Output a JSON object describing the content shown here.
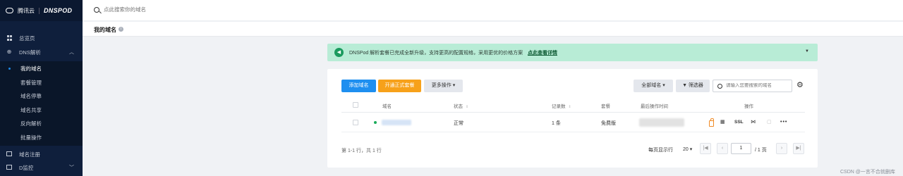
{
  "sidebar": {
    "brand": {
      "tencent": "腾讯云",
      "dnspod": "DNSPOD"
    },
    "items": [
      {
        "label": "总览页",
        "icon": "grid-icon"
      },
      {
        "label": "DNS解析",
        "icon": "globe-icon",
        "expanded": true
      },
      {
        "label": "我的域名",
        "active": true
      },
      {
        "label": "套餐管理"
      },
      {
        "label": "域名停靠"
      },
      {
        "label": "域名共享"
      },
      {
        "label": "反向解析"
      },
      {
        "label": "批量操作"
      },
      {
        "label": "域名注册",
        "icon": "window-icon"
      },
      {
        "label": "D监控",
        "icon": "monitor-icon"
      }
    ]
  },
  "topbar": {
    "search_placeholder": "点此搜索你的域名"
  },
  "page": {
    "title": "我的域名"
  },
  "banner": {
    "text": "DNSPod 解析套餐已完成全新升级，支持更高的配置规格，采用更优的价格方案",
    "link": "点此查看详情",
    "bg_color": "#b8ecd6"
  },
  "toolbar": {
    "add_domain": "添加域名",
    "open_plan": "开通正式套餐",
    "more_actions": "更多操作",
    "all_domains": "全部域名",
    "filter": "筛选器",
    "search_placeholder": "请输入您要搜索的域名"
  },
  "table": {
    "columns": [
      "域名",
      "状态",
      "记录数",
      "套餐",
      "最后操作时间",
      "操作"
    ],
    "rows": [
      {
        "domain": "",
        "status": "正常",
        "records": "1 条",
        "plan": "免费版",
        "last_op_time": "",
        "ops": [
          "lock-icon",
          "grid-icon",
          "SSL",
          "code-icon",
          "doc-icon",
          "more-icon"
        ]
      }
    ]
  },
  "pagination": {
    "summary": "第 1-1 行，共 1 行",
    "per_page_label": "每页显示行",
    "per_page": "20",
    "current_page": "1",
    "total_pages": "/ 1 页"
  },
  "watermark": "CSDN @一言不合就删库",
  "colors": {
    "sidebar_bg": "#0f1f3c",
    "primary": "#1e8ff0",
    "warning": "#f7a11a",
    "success": "#1aab5a"
  }
}
